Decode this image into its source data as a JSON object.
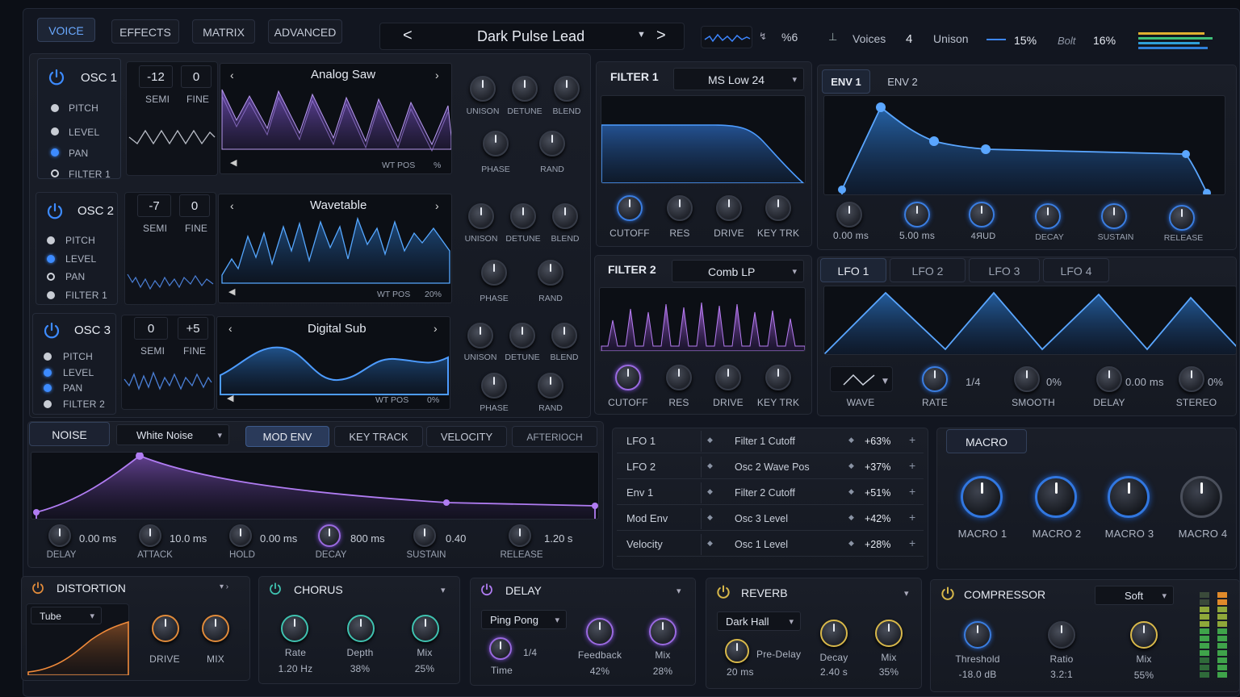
{
  "tabs": [
    "VOICE",
    "EFFECTS",
    "MATRIX",
    "ADVANCED"
  ],
  "preset": {
    "name": "Dark Pulse Lead",
    "prev": "<",
    "next": ">"
  },
  "topbar": {
    "voices_label": "Voices",
    "voices": "4",
    "unison_label": "Unison",
    "unison_val": "15%",
    "glide_label": "Bolt",
    "glide_val": "16%",
    "badge": "%6"
  },
  "osc": [
    {
      "title": "OSC 1",
      "semi": "-12",
      "fine": "0",
      "semi_l": "SEMI",
      "fine_l": "FINE",
      "wt": "Analog Saw",
      "wtpos": "WT POS",
      "wtval": "%",
      "routes": [
        "PITCH",
        "LEVEL",
        "PAN",
        "FILTER 1"
      ]
    },
    {
      "title": "OSC 2",
      "semi": "-7",
      "fine": "0",
      "semi_l": "SEMI",
      "fine_l": "FINE",
      "wt": "Wavetable",
      "wtpos": "WT POS",
      "wtval": "20%",
      "routes": [
        "PITCH",
        "LEVEL",
        "PAN",
        "FILTER 1"
      ]
    },
    {
      "title": "OSC 3",
      "semi": "0",
      "fine": "+5",
      "semi_l": "SEMI",
      "fine_l": "FINE",
      "wt": "Digital Sub",
      "wtpos": "WT POS",
      "wtval": "0%",
      "routes": [
        "PITCH",
        "LEVEL",
        "PAN",
        "FILTER 2"
      ]
    }
  ],
  "osc_knobs": [
    "UNISON",
    "DETUNE",
    "BLEND",
    "PHASE",
    "RAND"
  ],
  "filter1": {
    "title": "FILTER 1",
    "type": "MS Low 24",
    "knobs": [
      "CUTOFF",
      "RES",
      "DRIVE",
      "KEY TRK"
    ]
  },
  "filter2": {
    "title": "FILTER 2",
    "type": "Comb LP",
    "knobs": [
      "CUTOFF",
      "RES",
      "DRIVE",
      "KEY TRK"
    ]
  },
  "env": {
    "tabs": [
      "ENV 1",
      "ENV 2"
    ],
    "knobs": [
      {
        "l": "",
        "v": "0.00 ms"
      },
      {
        "l": "",
        "v": "5.00 ms"
      },
      {
        "l": "",
        "v": "4ЯUD"
      },
      {
        "l": "DECAY",
        "v": ""
      },
      {
        "l": "SUSTAIN",
        "v": ""
      },
      {
        "l": "RELEASE",
        "v": ""
      }
    ]
  },
  "lfo": {
    "tabs": [
      "LFO 1",
      "LFO 2",
      "LFO 3",
      "LFO 4"
    ],
    "wave": "WAVE",
    "rate": "RATE",
    "rate_val": "1/4",
    "smooth": "SMOOTH",
    "smooth_val": "0%",
    "delay": "DELAY",
    "delay_val": "0.00 ms",
    "stereo": "STEREO",
    "stereo_val": "0%"
  },
  "noise": {
    "title": "NOISE",
    "type": "White Noise",
    "tabs": [
      "MOD ENV",
      "KEY TRACK",
      "VELOCITY",
      "AFTERIOCH"
    ],
    "knobs": [
      {
        "l": "DELAY",
        "v": "0.00 ms"
      },
      {
        "l": "ATTACK",
        "v": "10.0 ms"
      },
      {
        "l": "HOLD",
        "v": "0.00 ms"
      },
      {
        "l": "DECAY",
        "v": "800 ms"
      },
      {
        "l": "SUSTAIN",
        "v": "0.40"
      },
      {
        "l": "RELEASE",
        "v": "1.20 s"
      }
    ]
  },
  "matrix": [
    {
      "src": "LFO 1",
      "dst": "Filter 1 Cutoff",
      "amt": "+63%"
    },
    {
      "src": "LFO 2",
      "dst": "Osc 2 Wave Pos",
      "amt": "+37%"
    },
    {
      "src": "Env 1",
      "dst": "Filter 2 Cutoff",
      "amt": "+51%"
    },
    {
      "src": "Mod Env",
      "dst": "Osc 3 Level",
      "amt": "+42%"
    },
    {
      "src": "Velocity",
      "dst": "Osc 1 Level",
      "amt": "+28%"
    }
  ],
  "macro": {
    "title": "MACRO",
    "knobs": [
      "MACRO 1",
      "MACRO 2",
      "MACRO 3",
      "MACRO 4"
    ]
  },
  "distortion": {
    "title": "DISTORTION",
    "type": "Tube",
    "drive": "DRIVE",
    "mix": "MIX"
  },
  "chorus": {
    "title": "CHORUS",
    "knobs": [
      {
        "l": "Rate",
        "v": "1.20 Hz"
      },
      {
        "l": "Depth",
        "v": "38%"
      },
      {
        "l": "Mix",
        "v": "25%"
      }
    ]
  },
  "delay": {
    "title": "DELAY",
    "mode": "Ping Pong",
    "time_l": "Time",
    "time_v": "1/4",
    "knobs": [
      {
        "l": "Feedback",
        "v": "42%"
      },
      {
        "l": "Mix",
        "v": "28%"
      }
    ]
  },
  "reverb": {
    "title": "REVERB",
    "type": "Dark Hall",
    "predelay_l": "Pre-Delay",
    "predelay_v": "20 ms",
    "knobs": [
      {
        "l": "Decay",
        "v": "2.40 s"
      },
      {
        "l": "Mix",
        "v": "35%"
      }
    ]
  },
  "compressor": {
    "title": "COMPRESSOR",
    "mode": "Soft",
    "knobs": [
      {
        "l": "Threshold",
        "v": "-18.0 dB"
      },
      {
        "l": "Ratio",
        "v": "3.2:1"
      },
      {
        "l": "Mix",
        "v": "55%"
      }
    ]
  }
}
